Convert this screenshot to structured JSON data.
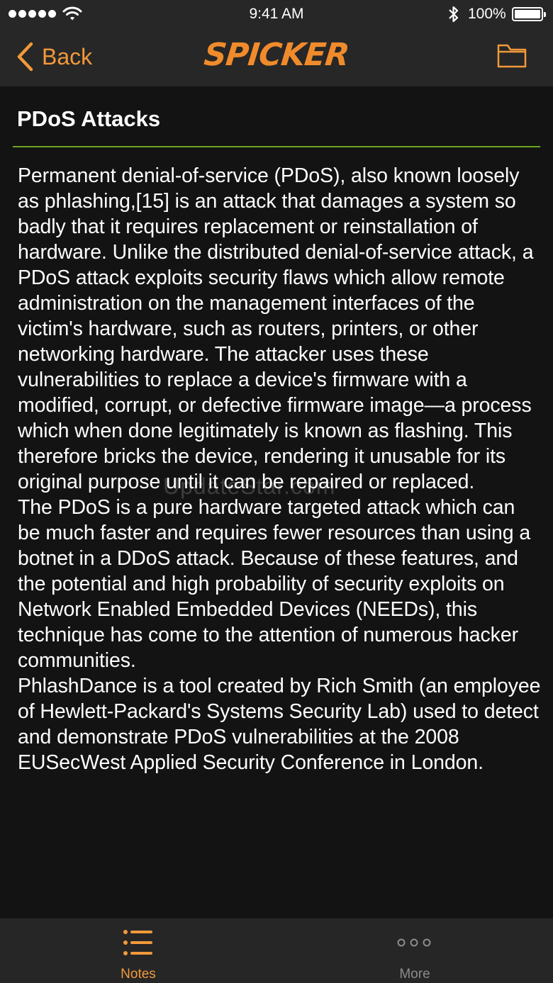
{
  "status_bar": {
    "time": "9:41 AM",
    "battery": "100%",
    "icons": [
      "signal-dots-icon",
      "wifi-icon",
      "bluetooth-icon",
      "battery-icon"
    ]
  },
  "nav": {
    "back_label": "Back",
    "logo_text": "SPICKER",
    "icons": [
      "chevron-left-icon",
      "folder-icon"
    ]
  },
  "article": {
    "title": "PDoS Attacks",
    "paragraphs": [
      "Permanent denial-of-service (PDoS), also known loosely as phlashing,[15] is an attack that damages a system so badly that it requires replacement or reinstallation of hardware. Unlike the distributed denial-of-service attack, a PDoS attack exploits security flaws which allow remote administration on the management interfaces of the victim's hardware, such as routers, printers, or other networking hardware. The attacker uses these vulnerabilities to replace a device's firmware with a modified, corrupt, or defective firmware image—a process which when done legitimately is known as flashing. This therefore bricks the device, rendering it unusable for its original purpose until it can be repaired or replaced.",
      "The PDoS is a pure hardware targeted attack which can be much faster and requires fewer resources than using a botnet in a DDoS attack. Because of these features, and the potential and high probability of security exploits on Network Enabled Embedded Devices (NEEDs), this technique has come to the attention of numerous hacker communities.",
      "PhlashDance is a tool created by Rich Smith (an employee of Hewlett-Packard's Systems Security Lab) used to detect and demonstrate PDoS vulnerabilities at the 2008 EUSecWest Applied Security Conference in London."
    ]
  },
  "watermark": "UpdateStar.com",
  "tabs": [
    {
      "label": "Notes",
      "icon": "list-icon",
      "active": true
    },
    {
      "label": "More",
      "icon": "more-dots-icon",
      "active": false
    }
  ],
  "colors": {
    "accent": "#f2993a",
    "divider": "#6aa521",
    "bar_background": "#272727",
    "page_background": "#131313"
  }
}
